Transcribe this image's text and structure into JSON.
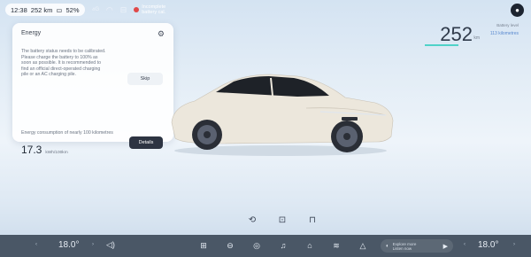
{
  "status": {
    "time": "12:38",
    "range": "252 km",
    "battery": "52%",
    "alert_line1": "Incomplete",
    "alert_line2": "battery cal."
  },
  "energy_card": {
    "title": "Energy",
    "message": "The battery status needs to be calibrated. Please charge the battery to 100% as soon as possible. It is recommended to find an official direct-operated charging pile or an AC charging pile.",
    "skip_label": "Skip",
    "consumption_label": "Energy consumption of nearly 100 kilometres",
    "consumption_value": "17.3",
    "consumption_unit": "kWh/100km",
    "details_label": "Details"
  },
  "range": {
    "value": "252",
    "unit": "km",
    "side_label": "Battery level",
    "side_value": "113 kilometres"
  },
  "dock": {
    "temp_left": "18.0°",
    "temp_right": "18.0°",
    "media_title": "Explore more",
    "media_sub": "Listen now"
  },
  "colors": {
    "dock_bg": "#4a5766",
    "accent_teal": "#4fd2c8",
    "car_body": "#ece7dc"
  }
}
